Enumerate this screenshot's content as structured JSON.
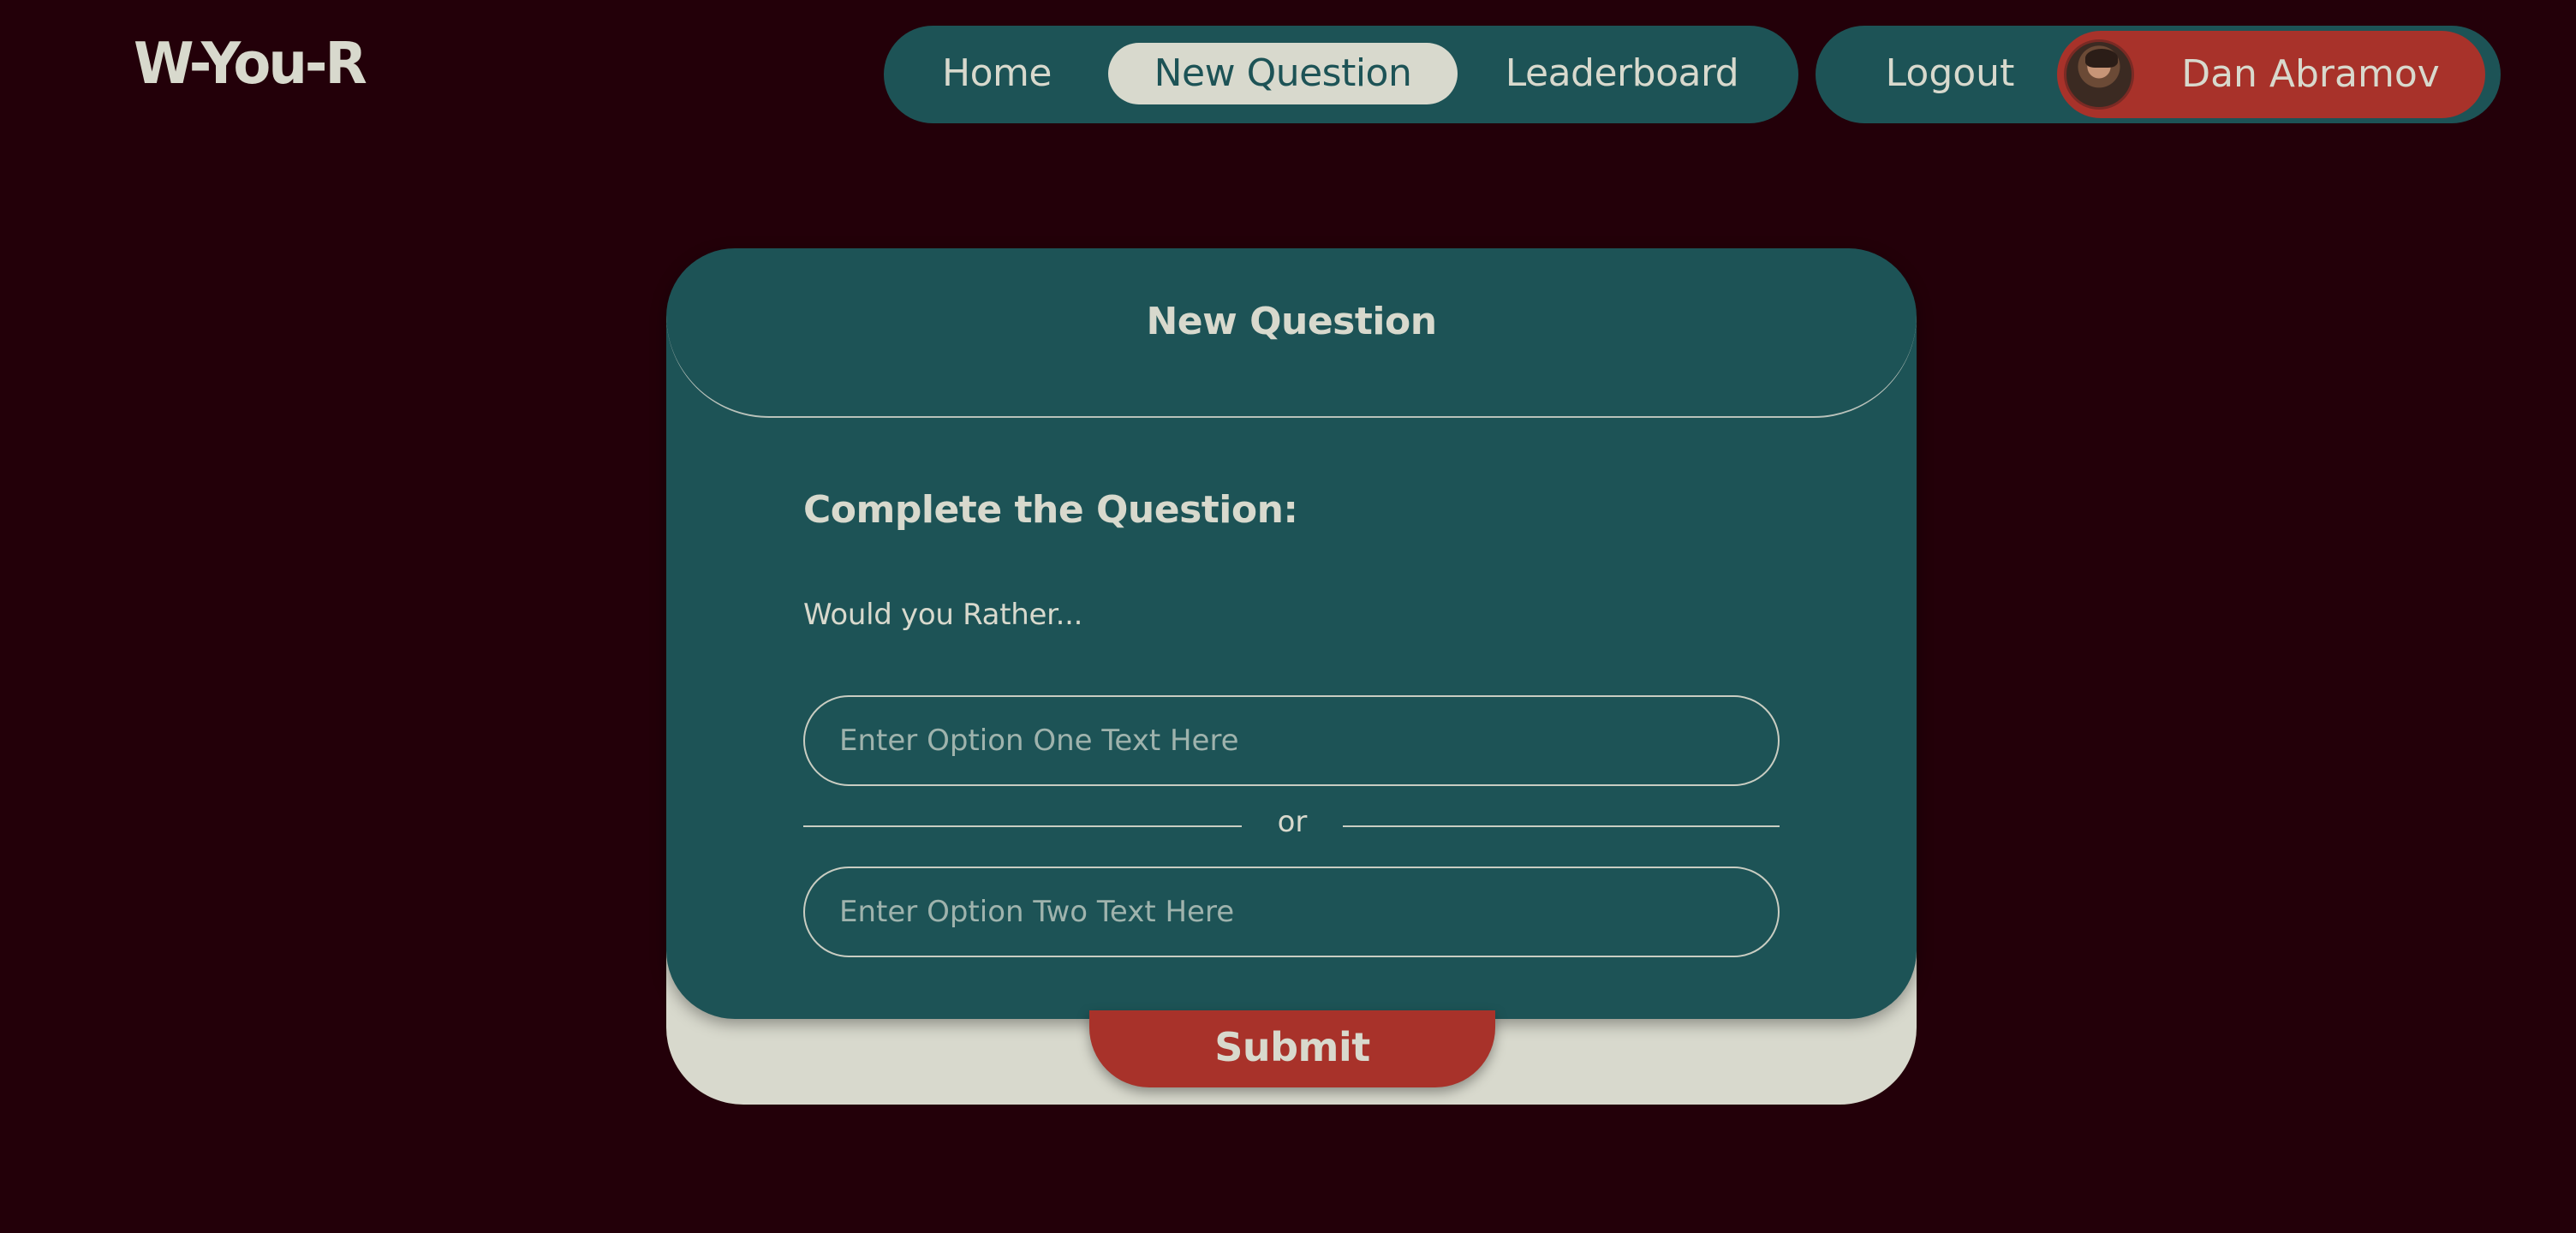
{
  "app": {
    "logo": "W-You-R"
  },
  "nav": {
    "items": [
      {
        "label": "Home",
        "active": false
      },
      {
        "label": "New Question",
        "active": true
      },
      {
        "label": "Leaderboard",
        "active": false
      }
    ]
  },
  "user": {
    "logout_label": "Logout",
    "name": "Dan Abramov",
    "avatar_icon": "user-avatar"
  },
  "card": {
    "title": "New Question",
    "heading": "Complete the Question:",
    "prompt": "Would you Rather...",
    "option_one": {
      "value": "",
      "placeholder": "Enter Option One Text Here"
    },
    "divider_text": "or",
    "option_two": {
      "value": "",
      "placeholder": "Enter Option Two Text Here"
    },
    "submit_label": "Submit"
  },
  "colors": {
    "background": "#230009",
    "panel": "#1d5356",
    "accent": "#a8322a",
    "light": "#d8d9cd"
  }
}
